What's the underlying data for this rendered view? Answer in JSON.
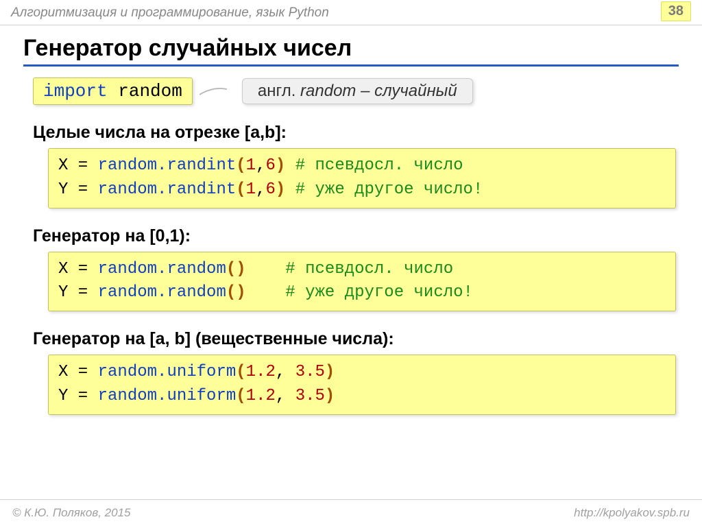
{
  "header": {
    "title": "Алгоритмизация и программирование, язык Python",
    "page": "38"
  },
  "title": "Генератор случайных чисел",
  "importLine": {
    "keyword": "import",
    "module": "random"
  },
  "note": {
    "prefix": "англ. ",
    "word": "random",
    "suffix": " – случайный"
  },
  "section1": {
    "heading": "Целые числа на отрезке [a,b]:",
    "code": [
      {
        "var": "X",
        "call": "random.randint",
        "args": [
          "1",
          "6"
        ],
        "comment": "# псевдосл. число"
      },
      {
        "var": "Y",
        "call": "random.randint",
        "args": [
          "1",
          "6"
        ],
        "comment": "# уже другое число!"
      }
    ]
  },
  "section2": {
    "heading": "Генератор на [0,1):",
    "code": [
      {
        "var": "X",
        "call": "random.random",
        "args": [],
        "pad": "   ",
        "comment": "# псевдосл. число"
      },
      {
        "var": "Y",
        "call": "random.random",
        "args": [],
        "pad": "   ",
        "comment": "# уже другое число!"
      }
    ]
  },
  "section3": {
    "heading": "Генератор на [a, b] (вещественные числа):",
    "code": [
      {
        "var": "X",
        "call": "random.uniform",
        "args": [
          "1.2",
          "3.5"
        ],
        "sep": ", "
      },
      {
        "var": "Y",
        "call": "random.uniform",
        "args": [
          "1.2",
          "3.5"
        ],
        "sep": ", "
      }
    ]
  },
  "footer": {
    "left": "© К.Ю. Поляков, 2015",
    "right": "http://kpolyakov.spb.ru"
  }
}
